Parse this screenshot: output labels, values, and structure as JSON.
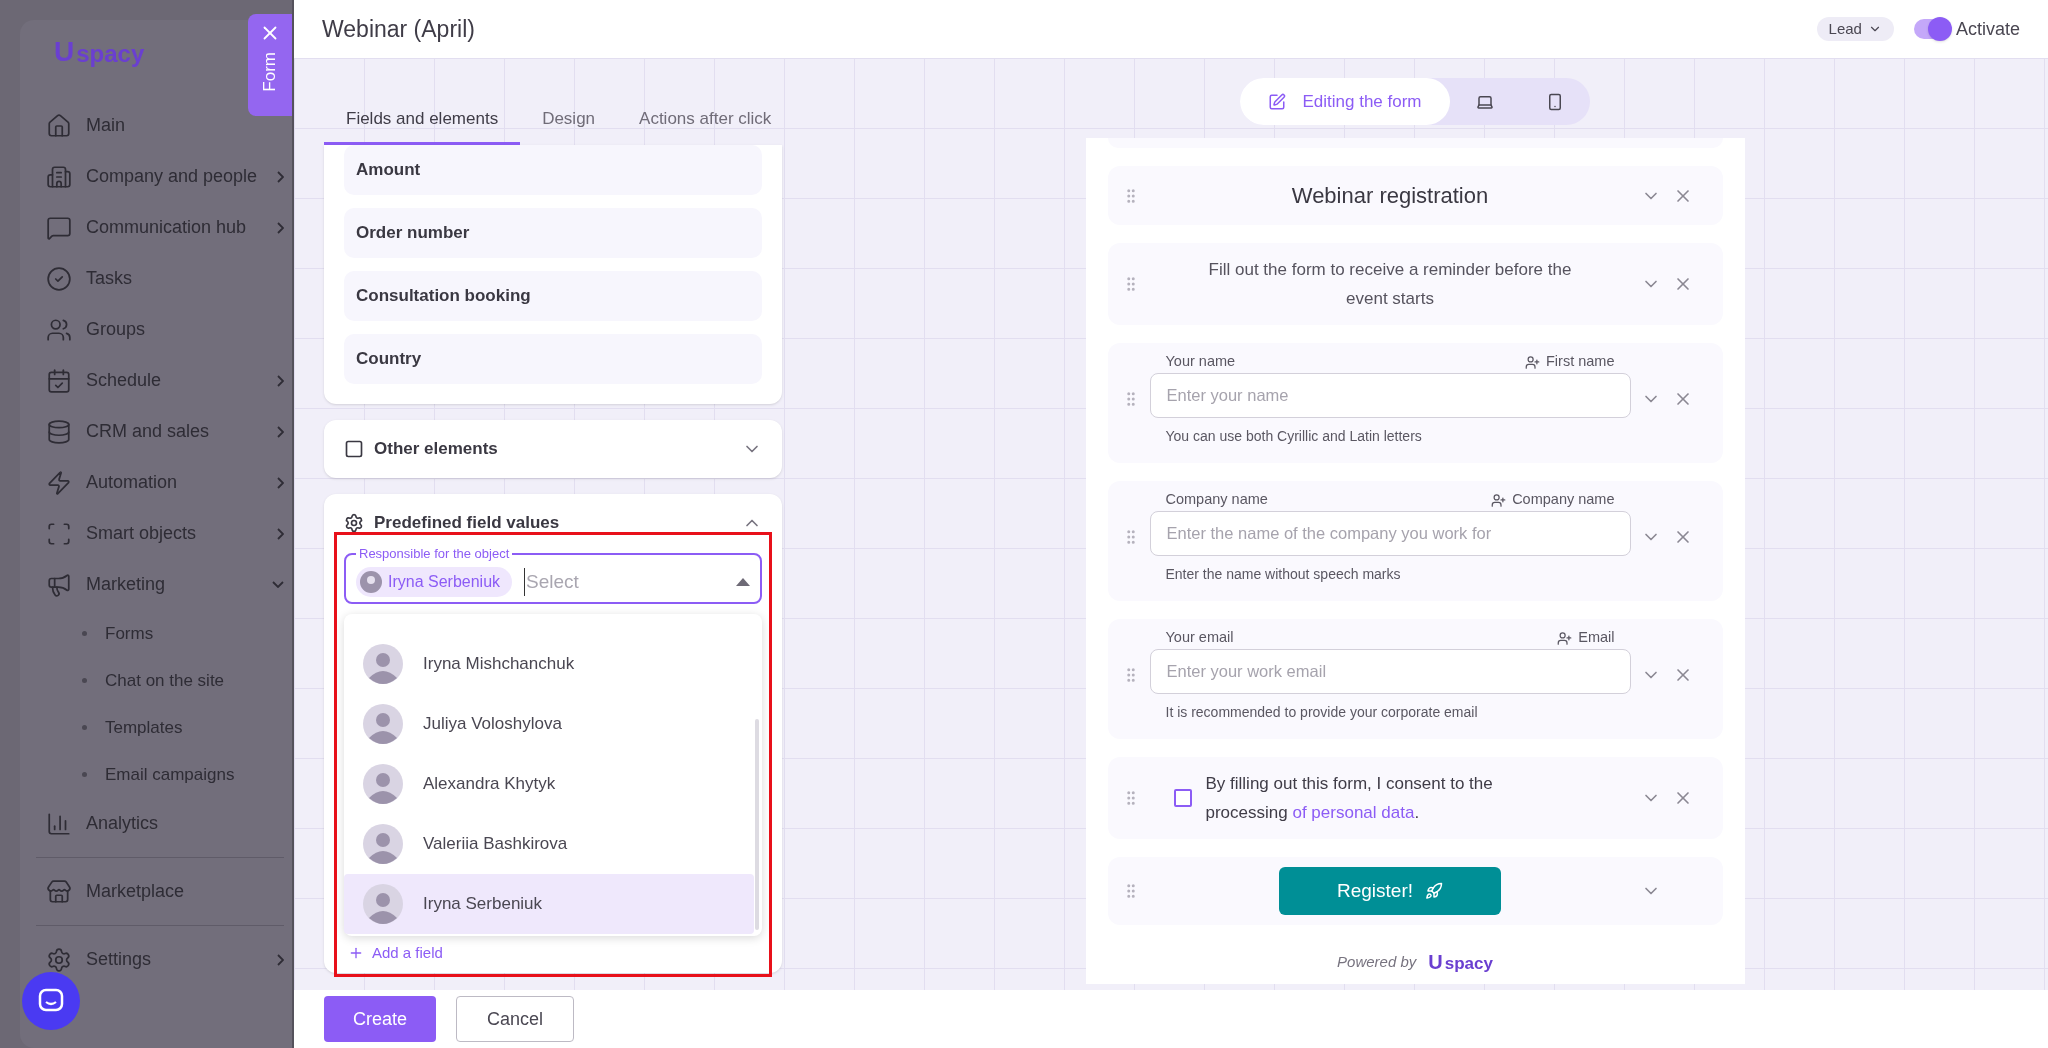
{
  "sidebar": {
    "logo": {
      "mark": "U",
      "text": "spacy"
    },
    "items": [
      {
        "label": "Main"
      },
      {
        "label": "Company and people",
        "expanded": false
      },
      {
        "label": "Communication hub",
        "expanded": false
      },
      {
        "label": "Tasks"
      },
      {
        "label": "Groups"
      },
      {
        "label": "Schedule",
        "expanded": false
      },
      {
        "label": "CRM and sales",
        "expanded": false
      },
      {
        "label": "Automation",
        "expanded": false
      },
      {
        "label": "Smart objects",
        "expanded": false
      },
      {
        "label": "Marketing",
        "expanded": true,
        "children": [
          "Forms",
          "Chat on the site",
          "Templates",
          "Email campaigns"
        ]
      },
      {
        "label": "Analytics"
      },
      {
        "label": "Marketplace"
      },
      {
        "label": "Settings",
        "expanded": false
      }
    ]
  },
  "form_tab": {
    "label": "Form"
  },
  "header": {
    "title": "Webinar (April)",
    "entity": "Lead",
    "activate": {
      "label": "Activate",
      "on": true
    }
  },
  "tabs": [
    {
      "label": "Fields and elements",
      "selected": true
    },
    {
      "label": "Design",
      "selected": false
    },
    {
      "label": "Actions after click",
      "selected": false
    }
  ],
  "fields": [
    "Amount",
    "Order number",
    "Consultation booking",
    "Country"
  ],
  "sections": [
    {
      "title": "Other elements",
      "expanded": false
    },
    {
      "title": "Predefined field values",
      "expanded": true
    }
  ],
  "responsible": {
    "label": "Responsible for the object",
    "chips": [
      "Iryna Serbeniuk"
    ],
    "placeholder": "Select",
    "open": true,
    "options": [
      {
        "name": "Iryna Mishchanchuk",
        "selected": false
      },
      {
        "name": "Juliya Voloshylova",
        "selected": false
      },
      {
        "name": "Alexandra Khytyk",
        "selected": false
      },
      {
        "name": "Valeriia Bashkirova",
        "selected": false
      },
      {
        "name": "Iryna Serbeniuk",
        "selected": true
      }
    ],
    "add_field": "Add a field"
  },
  "footer": {
    "create": "Create",
    "cancel": "Cancel"
  },
  "view_switch": [
    {
      "kind": "edit",
      "label": "Editing the form",
      "selected": true
    },
    {
      "kind": "desktop",
      "selected": false
    },
    {
      "kind": "mobile",
      "selected": false
    }
  ],
  "form": {
    "blocks": [
      {
        "kind": "title",
        "text": "Webinar registration",
        "removable": true
      },
      {
        "kind": "text",
        "text": "Fill out the form to receive a reminder before the event starts",
        "removable": true
      },
      {
        "kind": "field",
        "label": "Your name",
        "mapping": "First name",
        "placeholder": "Enter your name",
        "hint": "You can use both Cyrillic and Latin letters",
        "removable": true
      },
      {
        "kind": "field",
        "label": "Company name",
        "mapping": "Company name",
        "placeholder": "Enter the name of the company you work for",
        "hint": "Enter the name without speech marks",
        "removable": true
      },
      {
        "kind": "field",
        "label": "Your email",
        "mapping": "Email",
        "placeholder": "Enter your work email",
        "hint": "It is recommended to provide your corporate email",
        "removable": true
      },
      {
        "kind": "consent",
        "text": "By filling out this form, I consent to the processing",
        "link": "of personal data",
        "tail": ".",
        "checked": false,
        "removable": true
      },
      {
        "kind": "button",
        "text": "Register!",
        "removable": false
      }
    ],
    "powered_by": "Powered by",
    "logo": {
      "mark": "U",
      "text": "spacy"
    }
  }
}
